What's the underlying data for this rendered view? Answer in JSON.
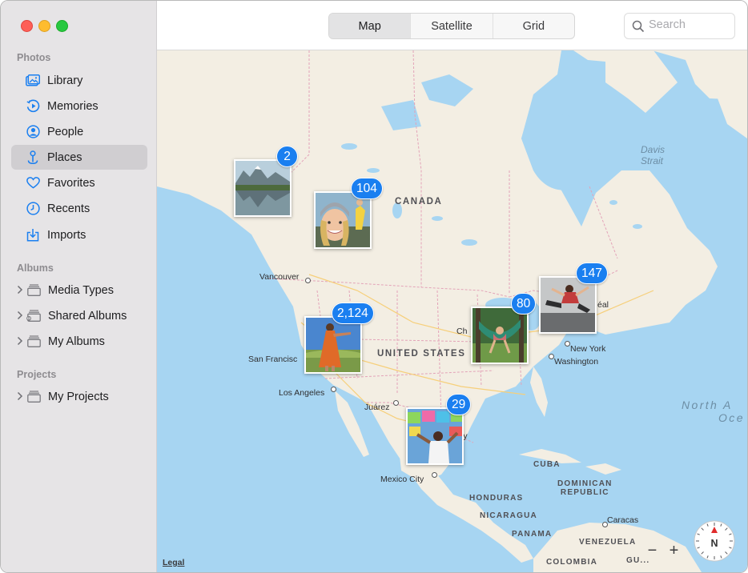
{
  "window": {
    "controls": [
      "close",
      "minimize",
      "zoom"
    ]
  },
  "sidebar": {
    "sections": {
      "photos": "Photos",
      "albums": "Albums",
      "projects": "Projects"
    },
    "photos_items": [
      {
        "label": "Library",
        "icon": "library-icon"
      },
      {
        "label": "Memories",
        "icon": "memories-icon"
      },
      {
        "label": "People",
        "icon": "people-icon"
      },
      {
        "label": "Places",
        "icon": "places-icon",
        "selected": true
      },
      {
        "label": "Favorites",
        "icon": "heart-icon"
      },
      {
        "label": "Recents",
        "icon": "clock-icon"
      },
      {
        "label": "Imports",
        "icon": "imports-icon"
      }
    ],
    "albums_items": [
      {
        "label": "Media Types",
        "icon": "folder-stack-icon"
      },
      {
        "label": "Shared Albums",
        "icon": "shared-folder-icon"
      },
      {
        "label": "My Albums",
        "icon": "folder-stack-icon"
      }
    ],
    "projects_items": [
      {
        "label": "My Projects",
        "icon": "folder-stack-icon"
      }
    ]
  },
  "toolbar": {
    "view_modes": [
      "Map",
      "Satellite",
      "Grid"
    ],
    "active_mode": "Map",
    "search": {
      "placeholder": "Search",
      "value": ""
    }
  },
  "map": {
    "legal": "Legal",
    "zoom_out": "−",
    "zoom_in": "+",
    "compass_label": "N",
    "countries": {
      "canada": "CANADA",
      "usa": "UNITED STATES",
      "cuba": "CUBA",
      "dominican": [
        "DOMINICAN",
        "REPUBLIC"
      ],
      "honduras": "HONDURAS",
      "nicaragua": "NICARAGUA",
      "panama": "PANAMA",
      "venezuela": "VENEZUELA",
      "colombia": "COLOMBIA",
      "guyana": "GU..."
    },
    "water": {
      "davis": [
        "Davis",
        "Strait"
      ],
      "atlantic": [
        "North A",
        "Oce"
      ]
    },
    "cities": {
      "vancouver": "Vancouver",
      "san_francisco": "San Francisc",
      "los_angeles": "Los Angeles",
      "juarez": "Juárez",
      "mexico_city": "Mexico City",
      "new_york": "New York",
      "washington": "Washington",
      "montreal": "éal",
      "chicago": "Ch",
      "houston": "rey",
      "caracas": "Caracas"
    },
    "photo_pins": [
      {
        "count": "2",
        "subject": "mountain-lake-photo"
      },
      {
        "count": "104",
        "subject": "selfie-photo"
      },
      {
        "count": "2,124",
        "subject": "orange-dress-photo"
      },
      {
        "count": "80",
        "subject": "hammock-photo"
      },
      {
        "count": "147",
        "subject": "jumping-photo"
      },
      {
        "count": "29",
        "subject": "papel-picado-photo"
      }
    ]
  },
  "colors": {
    "accent": "#1a7ff0",
    "map_water": "#a7d5f2",
    "map_land": "#f3eee3",
    "sidebar_bg": "#e6e4e6",
    "selection": "#d0ced1"
  }
}
